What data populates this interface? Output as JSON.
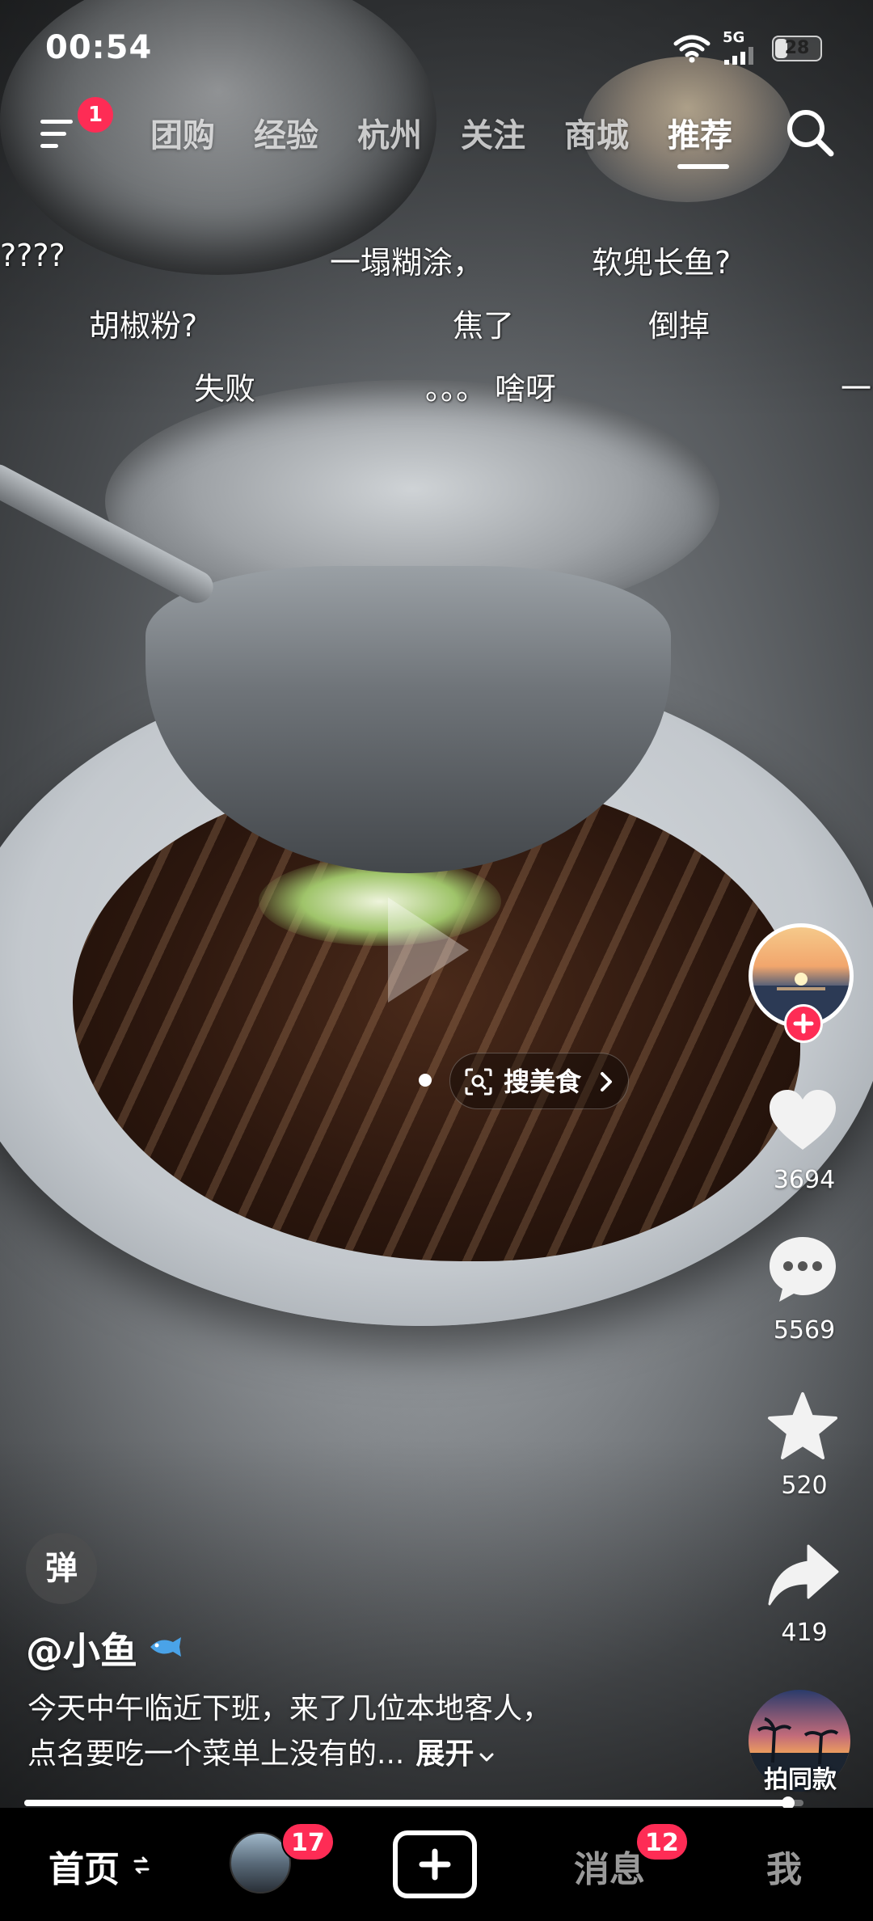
{
  "status_bar": {
    "time": "00:54",
    "network": "5G",
    "battery": "28",
    "battery_level": 0.28
  },
  "top_nav": {
    "menu_badge": "1",
    "tabs": [
      {
        "label": "团购",
        "active": false
      },
      {
        "label": "经验",
        "active": false
      },
      {
        "label": "杭州",
        "active": false
      },
      {
        "label": "关注",
        "active": false
      },
      {
        "label": "商城",
        "active": false
      },
      {
        "label": "推荐",
        "active": true
      }
    ]
  },
  "danmaku": [
    "????",
    "一塌糊涂，",
    "软兜长鱼?",
    "胡椒粉?",
    "焦了",
    "倒掉",
    "失败",
    "。。。",
    "啥呀",
    "一"
  ],
  "overlay": {
    "search_pill_label": "搜美食"
  },
  "right_rail": {
    "like_count": "3694",
    "comment_count": "5569",
    "favorite_count": "520",
    "share_count": "419",
    "remix_label": "拍同款"
  },
  "video_info": {
    "danmaku_toggle": "弹",
    "author": "@小鱼",
    "caption_line1": "今天中午临近下班，来了几位本地客人，",
    "caption_line2": "点名要吃一个菜单上没有的...",
    "expand_label": "展开",
    "progress": 0.98
  },
  "bottom_tabs": {
    "home": "首页",
    "friends_badge": "17",
    "messages": "消息",
    "messages_badge": "12",
    "me": "我"
  },
  "colors": {
    "accent_red": "#fe2c55",
    "tab_bar_bg": "#000000"
  },
  "icons": [
    "menu-icon",
    "search-icon",
    "wifi-icon",
    "signal-icon",
    "heart-icon",
    "comment-icon",
    "star-icon",
    "share-icon",
    "plus-icon",
    "fish-emoji-icon",
    "scan-icon",
    "chevron-right-icon",
    "chevron-down-icon"
  ]
}
